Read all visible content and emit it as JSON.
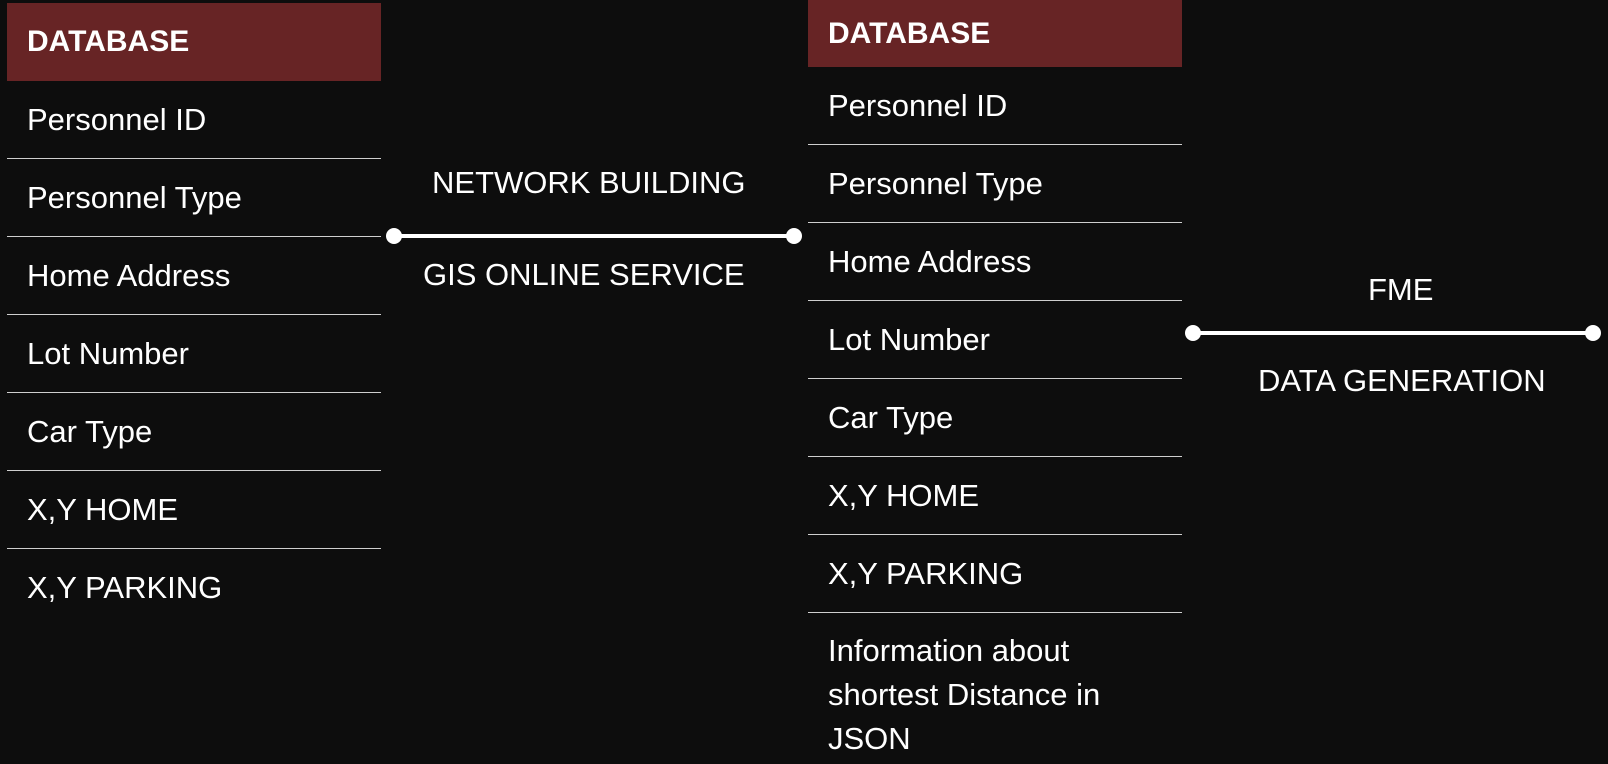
{
  "left_table": {
    "header": "DATABASE",
    "rows": [
      "Personnel ID",
      "Personnel Type",
      "Home Address",
      "Lot Number",
      "Car Type",
      "X,Y HOME",
      "X,Y PARKING"
    ]
  },
  "right_table": {
    "header": "DATABASE",
    "rows": [
      "Personnel ID",
      "Personnel Type",
      "Home Address",
      "Lot Number",
      "Car Type",
      "X,Y HOME",
      "X,Y PARKING",
      "Information about shortest Distance in JSON"
    ]
  },
  "connector_1": {
    "top_label": "NETWORK BUILDING",
    "bottom_label": "GIS ONLINE SERVICE"
  },
  "connector_2": {
    "top_label": "FME",
    "bottom_label": "DATA GENERATION"
  },
  "colors": {
    "background": "#0d0d0d",
    "header": "#672425",
    "text": "#ffffff"
  }
}
